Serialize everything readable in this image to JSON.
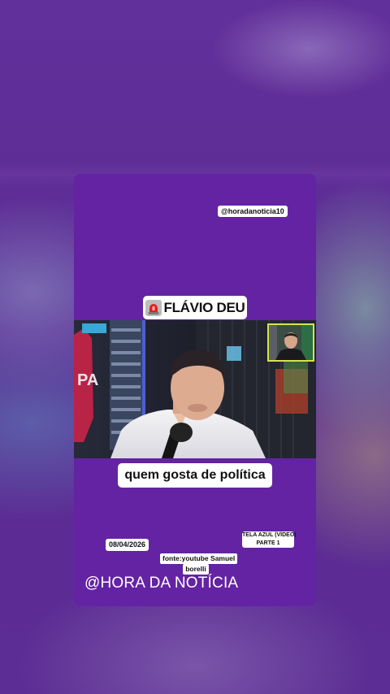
{
  "overlay": {
    "handle": "@horadanoticia10",
    "headline": "FLÁVIO DEU",
    "headline_icon": "siren-icon",
    "caption": "quem gosta de política",
    "date": "08/04/2026",
    "tela_line1": "TELA AZUL (VÍDEO)",
    "tela_line2": "PARTE 1",
    "source_line1": "fonte:youtube Samuel",
    "source_line2": "borelli",
    "brand": "@HORA DA NOTÍCIA"
  },
  "colors": {
    "card": "#6423a3",
    "background": "#5b2b93",
    "label_bg": "#ffffff",
    "siren": "#e02020",
    "pip_border": "#d7e24c"
  }
}
